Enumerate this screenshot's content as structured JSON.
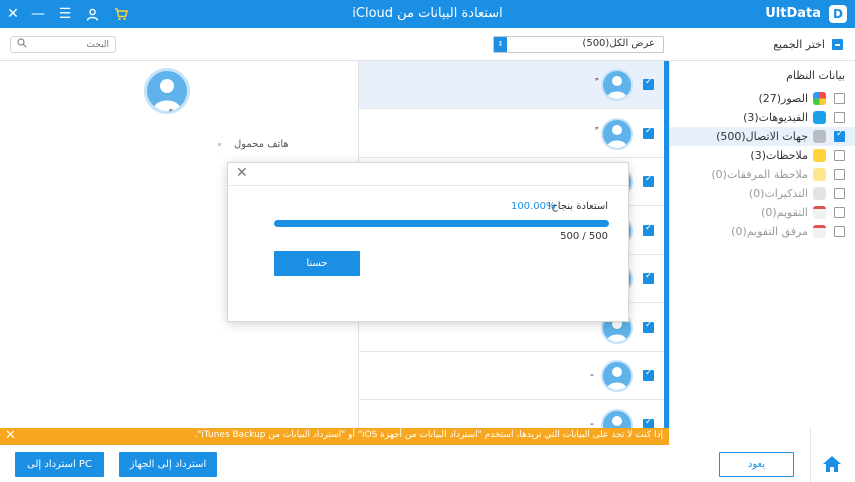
{
  "titlebar": {
    "title": "استعادة البيانات من iCloud",
    "app_name": "UltData",
    "logo_letter": "D",
    "controls": [
      "close-icon",
      "minimize-icon",
      "menu-icon",
      "user-icon",
      "cart-icon"
    ]
  },
  "toolbar": {
    "search_placeholder": "البحث",
    "filter_value": "عرض الكل(500)",
    "select_all_label": "اختر الجميع"
  },
  "sidebar": {
    "section_title": "بيانات النظام",
    "items": [
      {
        "label": "الصور(27)",
        "checked": false,
        "enabled": true,
        "icon": "photos-icon"
      },
      {
        "label": "الفيديوهات(3)",
        "checked": false,
        "enabled": true,
        "icon": "videos-icon"
      },
      {
        "label": "جهات الاتصال(500)",
        "checked": true,
        "enabled": true,
        "icon": "contacts-icon"
      },
      {
        "label": "ملاحظات(3)",
        "checked": false,
        "enabled": true,
        "icon": "notes-icon"
      },
      {
        "label": "ملاحظة المرفقات(0)",
        "checked": false,
        "enabled": false,
        "icon": "note-attachments-icon"
      },
      {
        "label": "التذكيرات(0)",
        "checked": false,
        "enabled": false,
        "icon": "reminders-icon"
      },
      {
        "label": "التقويم(0)",
        "checked": false,
        "enabled": false,
        "icon": "calendar-icon"
      },
      {
        "label": "مرفق التقويم(0)",
        "checked": false,
        "enabled": false,
        "icon": "calendar-attachment-icon"
      }
    ]
  },
  "contacts": [
    {
      "name": "ً"
    },
    {
      "name": "ً"
    },
    {
      "name": ""
    },
    {
      "name": ""
    },
    {
      "name": ""
    },
    {
      "name": ""
    },
    {
      "name": "-"
    },
    {
      "name": "-"
    },
    {
      "name": ""
    }
  ],
  "detail": {
    "name": "ً",
    "field_label": "هاتف محمول"
  },
  "dialog": {
    "message": "استعادة بنجاح!",
    "percent_text": "100.00%",
    "progress": 1.0,
    "count_text": "500 / 500",
    "ok_label": "حسنا"
  },
  "warning": {
    "text": "إذا كنت لا تجد على البيانات التي تريدها، استخدم \"استرداد البيانات من أجهزة iOS\" أو \"استرداد البيانات من iTunes Backup\"."
  },
  "bottom": {
    "to_pc_label": "استرداد إلى PC",
    "to_device_label": "استرداد إلى الجهاز",
    "back_label": "يعود"
  }
}
